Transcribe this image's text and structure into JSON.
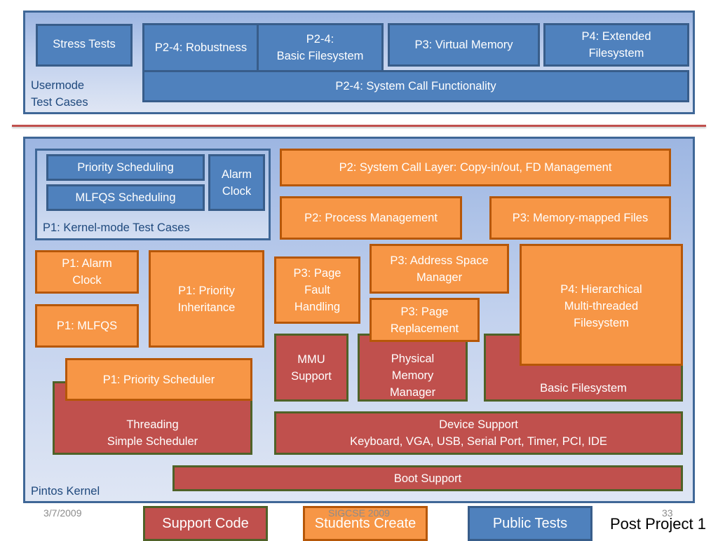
{
  "usermode": {
    "label": "Usermode\nTest Cases",
    "stress_tests": "Stress Tests",
    "robustness": "P2-4: Robustness",
    "basic_filesystem": "P2-4:\nBasic Filesystem",
    "virtual_memory": "P3: Virtual Memory",
    "extended_filesystem": "P4: Extended\nFilesystem",
    "syscall_functionality": "P2-4: System Call Functionality"
  },
  "kernel": {
    "label": "Pintos Kernel",
    "kernel_tests": {
      "label": "P1: Kernel-mode Test Cases",
      "priority_scheduling": "Priority Scheduling",
      "mlfqs_scheduling": "MLFQS Scheduling",
      "alarm_clock": "Alarm\nClock"
    },
    "syscall_layer": "P2: System Call Layer: Copy-in/out, FD Management",
    "process_management": "P2: Process Management",
    "memory_mapped_files": "P3: Memory-mapped Files",
    "p1_alarm_clock": "P1: Alarm\nClock",
    "p1_mlfqs": "P1: MLFQS",
    "p1_priority_inheritance": "P1: Priority\nInheritance",
    "p1_priority_scheduler": "P1: Priority Scheduler",
    "threading": "Threading\nSimple Scheduler",
    "page_fault_handling": "P3: Page\nFault\nHandling",
    "address_space_manager": "P3: Address Space\nManager",
    "page_replacement": "P3: Page\nReplacement",
    "mmu_support": "MMU\nSupport",
    "physical_memory_manager": "Physical\nMemory\nManager",
    "hierarchical_filesystem": "P4: Hierarchical\nMulti-threaded\nFilesystem",
    "basic_filesystem": "Basic Filesystem",
    "device_support": "Device Support\nKeyboard, VGA, USB, Serial Port, Timer, PCI, IDE",
    "boot_support": "Boot Support"
  },
  "legend": {
    "support_code": "Support Code",
    "students_create": "Students Create",
    "public_tests": "Public Tests",
    "caption": "Post Project 1"
  },
  "footer": {
    "date": "3/7/2009",
    "conference": "SIGCSE 2009",
    "page_number": "33"
  },
  "colors": {
    "support_code": "#c0504d",
    "students_create": "#f79646",
    "public_tests": "#4f81bd"
  }
}
